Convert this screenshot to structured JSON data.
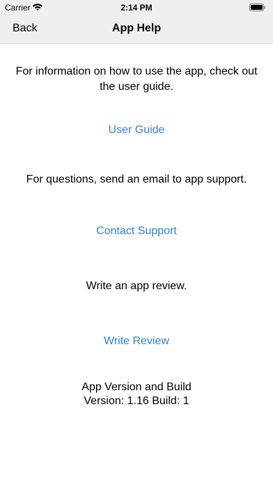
{
  "status_bar": {
    "carrier": "Carrier",
    "time": "2:14 PM",
    "wifi_icon": "wifi-icon",
    "battery_icon": "battery-icon"
  },
  "nav": {
    "back_label": "Back",
    "title": "App Help"
  },
  "sections": {
    "guide_text": "For information on how to use the app, check out the user guide.",
    "guide_link": "User Guide",
    "support_text": "For questions, send an email to app support.",
    "support_link": "Contact Support",
    "review_text": "Write an app review.",
    "review_link": "Write Review"
  },
  "version": {
    "heading": "App Version and Build",
    "value": "Version: 1.16 Build: 1"
  },
  "colors": {
    "link": "#2f7fd6",
    "bar_background": "#efefef"
  }
}
